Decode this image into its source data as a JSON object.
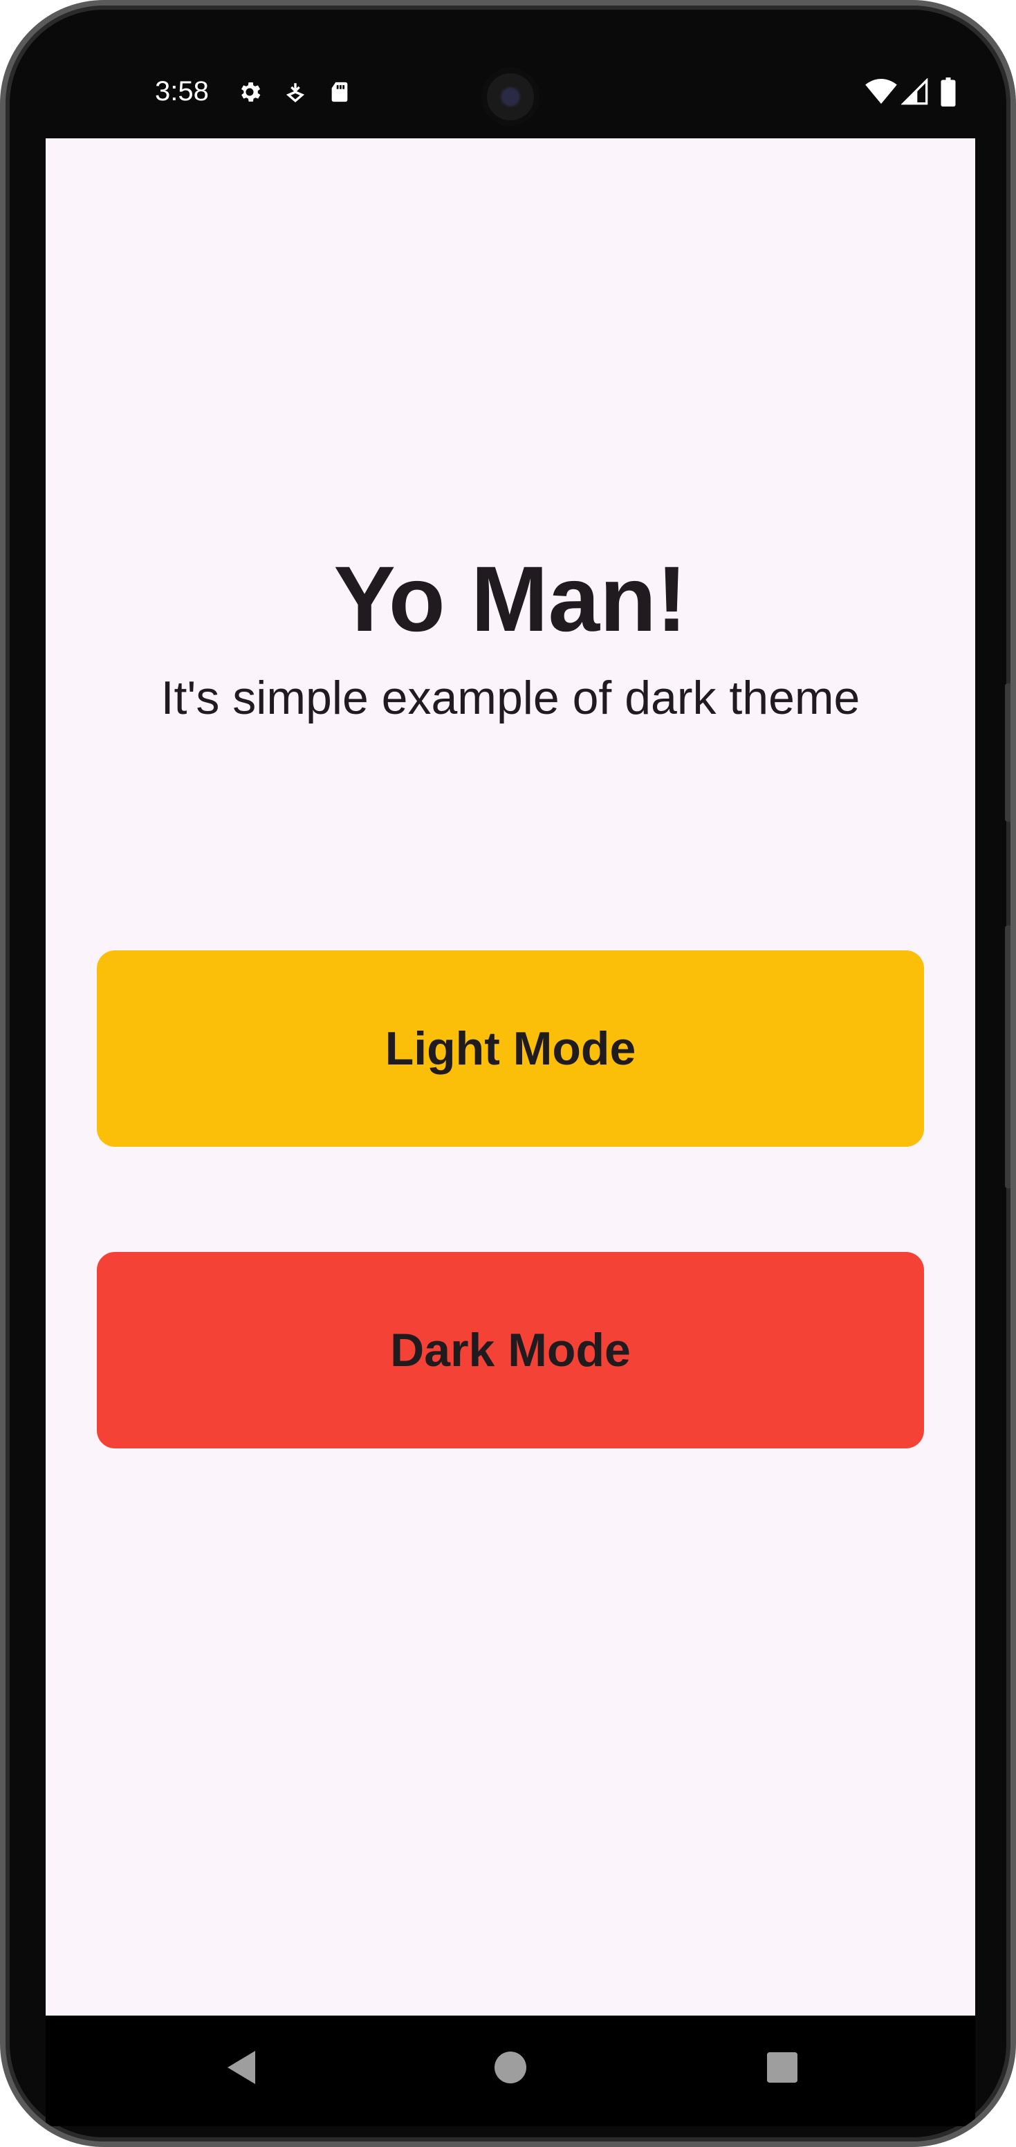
{
  "status_bar": {
    "time": "3:58",
    "icons_left": [
      "gear-icon",
      "download-icon",
      "sd-card-icon"
    ],
    "icons_right": [
      "wifi-icon",
      "signal-icon",
      "battery-icon"
    ]
  },
  "app": {
    "title": "Yo Man!",
    "subtitle": "It's simple example of dark theme",
    "background_color": "#fcf4fb",
    "buttons": [
      {
        "label": "Light Mode",
        "color": "#fbbf0a"
      },
      {
        "label": "Dark Mode",
        "color": "#f44336"
      }
    ]
  },
  "nav_bar": {
    "items": [
      "back-icon",
      "home-icon",
      "recents-icon"
    ]
  }
}
